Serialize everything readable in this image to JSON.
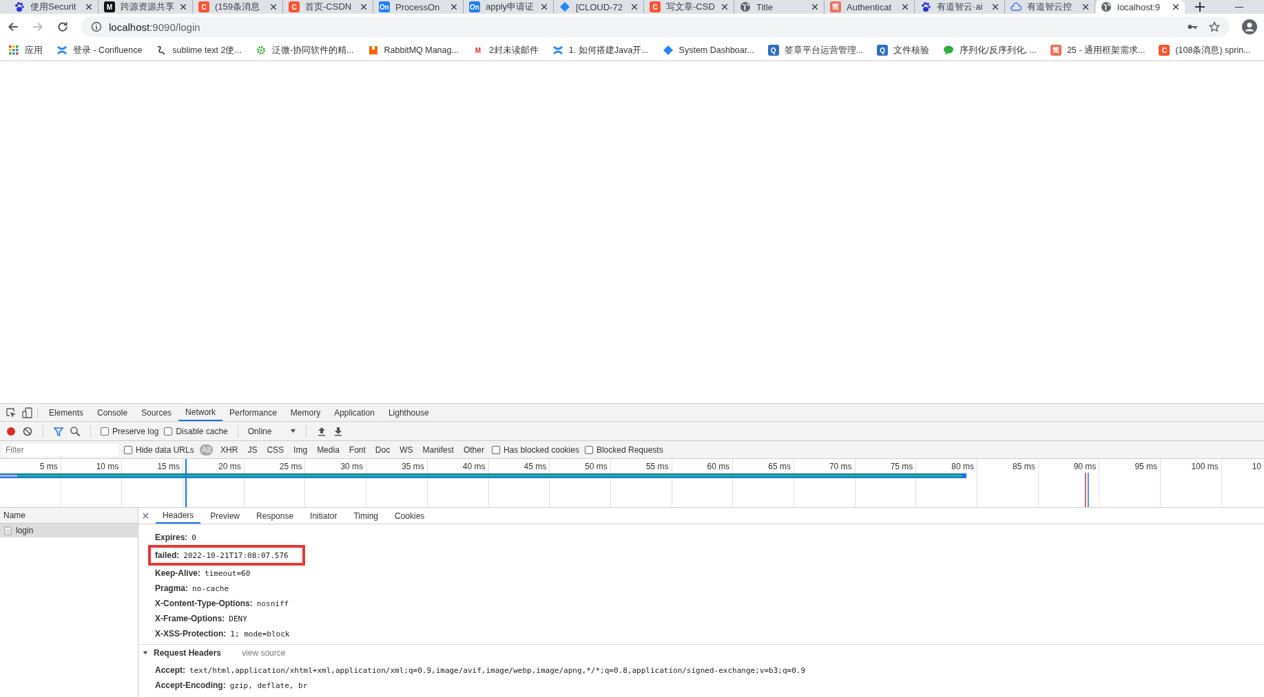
{
  "browser_tabs": [
    {
      "title": "使用Securit",
      "selected": false,
      "icon": {
        "kind": "paw",
        "color": "#2932e1"
      }
    },
    {
      "title": "跨源资源共享",
      "selected": false,
      "icon": {
        "kind": "tile",
        "text": "M",
        "color": "#111111"
      }
    },
    {
      "title": "(159条消息",
      "selected": false,
      "icon": {
        "kind": "tile",
        "text": "C",
        "color": "#fc5531"
      }
    },
    {
      "title": "首页-CSDN",
      "selected": false,
      "icon": {
        "kind": "tile",
        "text": "C",
        "color": "#fc5531"
      }
    },
    {
      "title": "ProcessOn",
      "selected": false,
      "icon": {
        "kind": "tile",
        "text": "On",
        "color": "#1e7ff0"
      }
    },
    {
      "title": "apply申请证",
      "selected": false,
      "icon": {
        "kind": "tile",
        "text": "On",
        "color": "#1e7ff0"
      }
    },
    {
      "title": "[CLOUD-72",
      "selected": false,
      "icon": {
        "kind": "diamond",
        "color": "#2684ff"
      }
    },
    {
      "title": "写文章-CSD",
      "selected": false,
      "icon": {
        "kind": "tile",
        "text": "C",
        "color": "#fc5531"
      }
    },
    {
      "title": "Title",
      "selected": false,
      "icon": {
        "kind": "globe",
        "color": "#5f6368"
      }
    },
    {
      "title": "Authenticat",
      "selected": false,
      "icon": {
        "kind": "tile",
        "text": "简",
        "color": "#ea6f5a"
      }
    },
    {
      "title": "有道智云·ai",
      "selected": false,
      "icon": {
        "kind": "paw",
        "color": "#2932e1"
      }
    },
    {
      "title": "有道智云控",
      "selected": false,
      "icon": {
        "kind": "cloud",
        "color": "#4a78f0"
      }
    },
    {
      "title": "localhost:9",
      "selected": true,
      "icon": {
        "kind": "globe",
        "color": "#5f6368"
      }
    }
  ],
  "address_bar": {
    "host": "localhost",
    "path": ":9090/login"
  },
  "bookmarks": [
    {
      "title": "应用",
      "icon": {
        "kind": "grid"
      }
    },
    {
      "title": "登录 - Confluence",
      "icon": {
        "kind": "cross",
        "color": "#2684ff"
      }
    },
    {
      "title": "sublime text 2使...",
      "icon": {
        "kind": "squiggle",
        "color": "#333333"
      }
    },
    {
      "title": "泛微-协同软件的精...",
      "icon": {
        "kind": "gear",
        "color": "#2aa52a"
      }
    },
    {
      "title": "RabbitMQ Manag...",
      "icon": {
        "kind": "blocks",
        "color": "#ff6600"
      }
    },
    {
      "title": "2封未读邮件",
      "icon": {
        "kind": "tile",
        "text": "M",
        "color": "#ffffff"
      }
    },
    {
      "title": "1. 如何搭建Java开...",
      "icon": {
        "kind": "cross",
        "color": "#2684ff"
      }
    },
    {
      "title": "System Dashboar...",
      "icon": {
        "kind": "diamond",
        "color": "#2684ff"
      }
    },
    {
      "title": "签章平台运营管理...",
      "icon": {
        "kind": "tile",
        "text": "Q",
        "color": "#2f6fbf"
      }
    },
    {
      "title": "文件核验",
      "icon": {
        "kind": "tile",
        "text": "Q",
        "color": "#2f6fbf"
      }
    },
    {
      "title": "序列化/反序列化, ...",
      "icon": {
        "kind": "bubble",
        "color": "#2aae3a"
      }
    },
    {
      "title": "25 - 通用框架需求...",
      "icon": {
        "kind": "tile",
        "text": "简",
        "color": "#ea6f5a"
      }
    },
    {
      "title": "(108条消息) sprin...",
      "icon": {
        "kind": "tile",
        "text": "C",
        "color": "#fc5531"
      }
    }
  ],
  "devtools": {
    "panels": [
      {
        "label": "Elements",
        "selected": false
      },
      {
        "label": "Console",
        "selected": false
      },
      {
        "label": "Sources",
        "selected": false
      },
      {
        "label": "Network",
        "selected": true
      },
      {
        "label": "Performance",
        "selected": false
      },
      {
        "label": "Memory",
        "selected": false
      },
      {
        "label": "Application",
        "selected": false
      },
      {
        "label": "Lighthouse",
        "selected": false
      }
    ],
    "toolbar": {
      "recording": true,
      "filter_active": true,
      "preserve_log": {
        "label": "Preserve log",
        "checked": false
      },
      "disable_cache": {
        "label": "Disable cache",
        "checked": false
      },
      "throttling": "Online"
    },
    "filter_bar": {
      "placeholder": "Filter",
      "hide_data_urls": {
        "label": "Hide data URLs",
        "checked": false
      },
      "types": [
        {
          "label": "All",
          "selected": true
        },
        {
          "label": "XHR",
          "selected": false
        },
        {
          "label": "JS",
          "selected": false
        },
        {
          "label": "CSS",
          "selected": false
        },
        {
          "label": "Img",
          "selected": false
        },
        {
          "label": "Media",
          "selected": false
        },
        {
          "label": "Font",
          "selected": false
        },
        {
          "label": "Doc",
          "selected": false
        },
        {
          "label": "WS",
          "selected": false
        },
        {
          "label": "Manifest",
          "selected": false
        },
        {
          "label": "Other",
          "selected": false
        }
      ],
      "has_blocked_cookies": {
        "label": "Has blocked cookies",
        "checked": false
      },
      "blocked_requests": {
        "label": "Blocked Requests",
        "checked": false
      }
    },
    "timeline_ticks": [
      "5 ms",
      "10 ms",
      "15 ms",
      "20 ms",
      "25 ms",
      "30 ms",
      "35 ms",
      "40 ms",
      "45 ms",
      "50 ms",
      "55 ms",
      "60 ms",
      "65 ms",
      "70 ms",
      "75 ms",
      "80 ms",
      "85 ms",
      "90 ms",
      "95 ms",
      "100 ms",
      "10"
    ],
    "requests": {
      "column": "Name",
      "rows": [
        {
          "name": "login",
          "selected": true
        }
      ]
    },
    "detail_tabs": [
      {
        "label": "Headers",
        "selected": true
      },
      {
        "label": "Preview",
        "selected": false
      },
      {
        "label": "Response",
        "selected": false
      },
      {
        "label": "Initiator",
        "selected": false
      },
      {
        "label": "Timing",
        "selected": false
      },
      {
        "label": "Cookies",
        "selected": false
      }
    ],
    "response_headers": [
      {
        "name": "Expires:",
        "value": "0",
        "highlighted": false
      },
      {
        "name": "failed:",
        "value": "2022-10-21T17:08:07.576",
        "highlighted": true
      },
      {
        "name": "Keep-Alive:",
        "value": "timeout=60",
        "highlighted": false
      },
      {
        "name": "Pragma:",
        "value": "no-cache",
        "highlighted": false
      },
      {
        "name": "X-Content-Type-Options:",
        "value": "nosniff",
        "highlighted": false
      },
      {
        "name": "X-Frame-Options:",
        "value": "DENY",
        "highlighted": false
      },
      {
        "name": "X-XSS-Protection:",
        "value": "1; mode=block",
        "highlighted": false
      }
    ],
    "request_section": {
      "title": "Request Headers",
      "expanded": true,
      "link": "view source",
      "headers": [
        {
          "name": "Accept:",
          "value": "text/html,application/xhtml+xml,application/xml;q=0.9,image/avif,image/webp,image/apng,*/*;q=0.8,application/signed-exchange;v=b3;q=0.9"
        },
        {
          "name": "Accept-Encoding:",
          "value": "gzip, deflate, br"
        }
      ]
    }
  }
}
